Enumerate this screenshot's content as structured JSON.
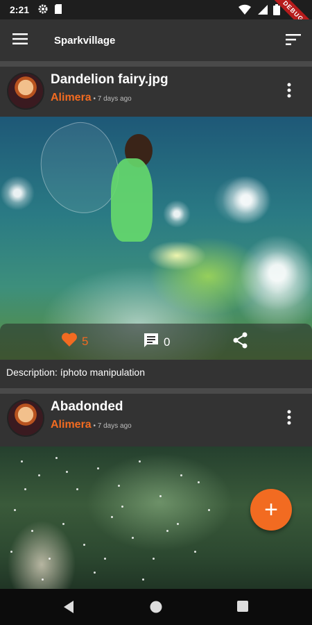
{
  "status_bar": {
    "time": "2:21",
    "icons": [
      "settings-icon",
      "sd-card-icon",
      "wifi-icon",
      "signal-icon",
      "battery-icon"
    ],
    "debug_banner": "DEBUG"
  },
  "app_bar": {
    "title": "Sparkvillage",
    "menu_icon": "hamburger-menu-icon",
    "sort_icon": "sort-icon"
  },
  "posts": [
    {
      "title": "Dandelion fairy.jpg",
      "author": "Alimera",
      "separator": " • ",
      "time_ago": "7 days ago",
      "likes": "5",
      "comments": "0",
      "description": "Description: íphoto manipulation"
    },
    {
      "title": "Abadonded",
      "author": "Alimera",
      "separator": " • ",
      "time_ago": "7 days ago"
    }
  ],
  "fab": {
    "label": "+"
  },
  "colors": {
    "accent": "#f26b21",
    "background": "#2b2b2b",
    "card": "#333333",
    "status_bar": "#1e1e1e",
    "nav_bar": "#0c0c0c"
  }
}
